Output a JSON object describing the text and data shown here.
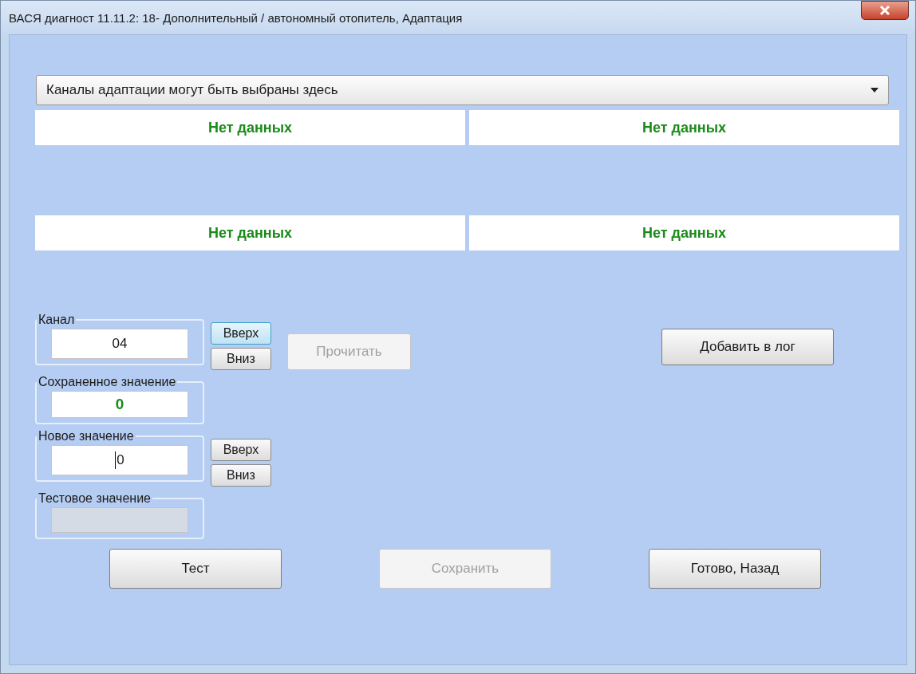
{
  "window": {
    "title": "ВАСЯ диагност 11.11.2: 18- Дополнительный / автономный отопитель, Адаптация"
  },
  "channel_dropdown": {
    "value": "Каналы адаптации могут быть выбраны здесь"
  },
  "data_fields": [
    {
      "value": "Нет данных"
    },
    {
      "value": "Нет данных"
    },
    {
      "value": "Нет данных"
    },
    {
      "value": "Нет данных"
    }
  ],
  "channel": {
    "label": "Канал",
    "value": "04",
    "buttons": [
      {
        "label": "Вверх",
        "focused": true
      },
      {
        "label": "Вниз",
        "focused": false
      }
    ]
  },
  "read_button": {
    "label": "Прочитать",
    "disabled": true
  },
  "add_to_log_button": {
    "label": "Добавить в лог",
    "disabled": false
  },
  "saved_value": {
    "label": "Сохраненное значение",
    "value": "0"
  },
  "new_value": {
    "label": "Новое значение",
    "value": "0",
    "focused": true,
    "buttons": [
      {
        "label": "Вверх",
        "focused": false
      },
      {
        "label": "Вниз",
        "focused": false
      }
    ]
  },
  "test_value": {
    "label": "Тестовое значение",
    "disabled": true
  },
  "bottom_buttons": [
    {
      "label": "Тест",
      "disabled": false
    },
    {
      "label": "Сохранить",
      "disabled": true
    },
    {
      "label": "Готово, Назад",
      "disabled": false
    }
  ]
}
